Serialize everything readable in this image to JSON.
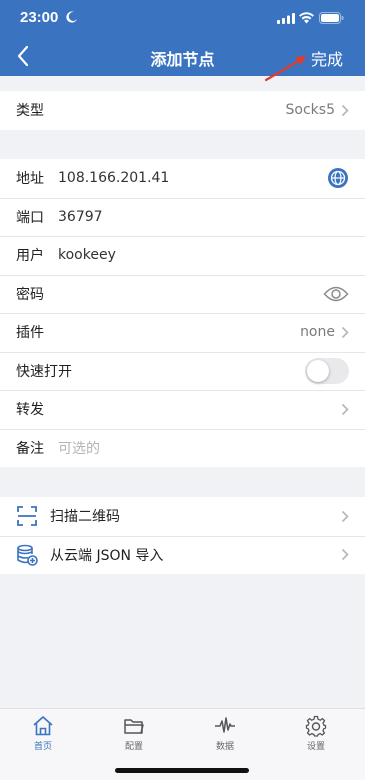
{
  "status_bar": {
    "time": "23:00"
  },
  "nav": {
    "title": "添加节点",
    "done_label": "完成"
  },
  "type_row": {
    "label": "类型",
    "value": "Socks5"
  },
  "form": {
    "address": {
      "label": "地址",
      "value": "108.166.201.41"
    },
    "port": {
      "label": "端口",
      "value": "36797"
    },
    "user": {
      "label": "用户",
      "value": "kookeey"
    },
    "password": {
      "label": "密码",
      "value": ""
    },
    "plugin": {
      "label": "插件",
      "value": "none"
    },
    "quick_open": {
      "label": "快速打开",
      "enabled": false
    },
    "forward": {
      "label": "转发"
    },
    "note": {
      "label": "备注",
      "placeholder": "可选的"
    }
  },
  "import": {
    "scan": {
      "label": "扫描二维码"
    },
    "cloud": {
      "label": "从云端 JSON 导入"
    }
  },
  "tabbar": {
    "tabs": [
      {
        "label": "首页",
        "icon": "home-icon",
        "active": true
      },
      {
        "label": "配置",
        "icon": "folder-icon",
        "active": false
      },
      {
        "label": "数据",
        "icon": "activity-icon",
        "active": false
      },
      {
        "label": "设置",
        "icon": "gear-icon",
        "active": false
      }
    ]
  },
  "colors": {
    "accent": "#3a73c0",
    "background": "#f1f2f6",
    "annotation_arrow": "#e23b2e"
  }
}
